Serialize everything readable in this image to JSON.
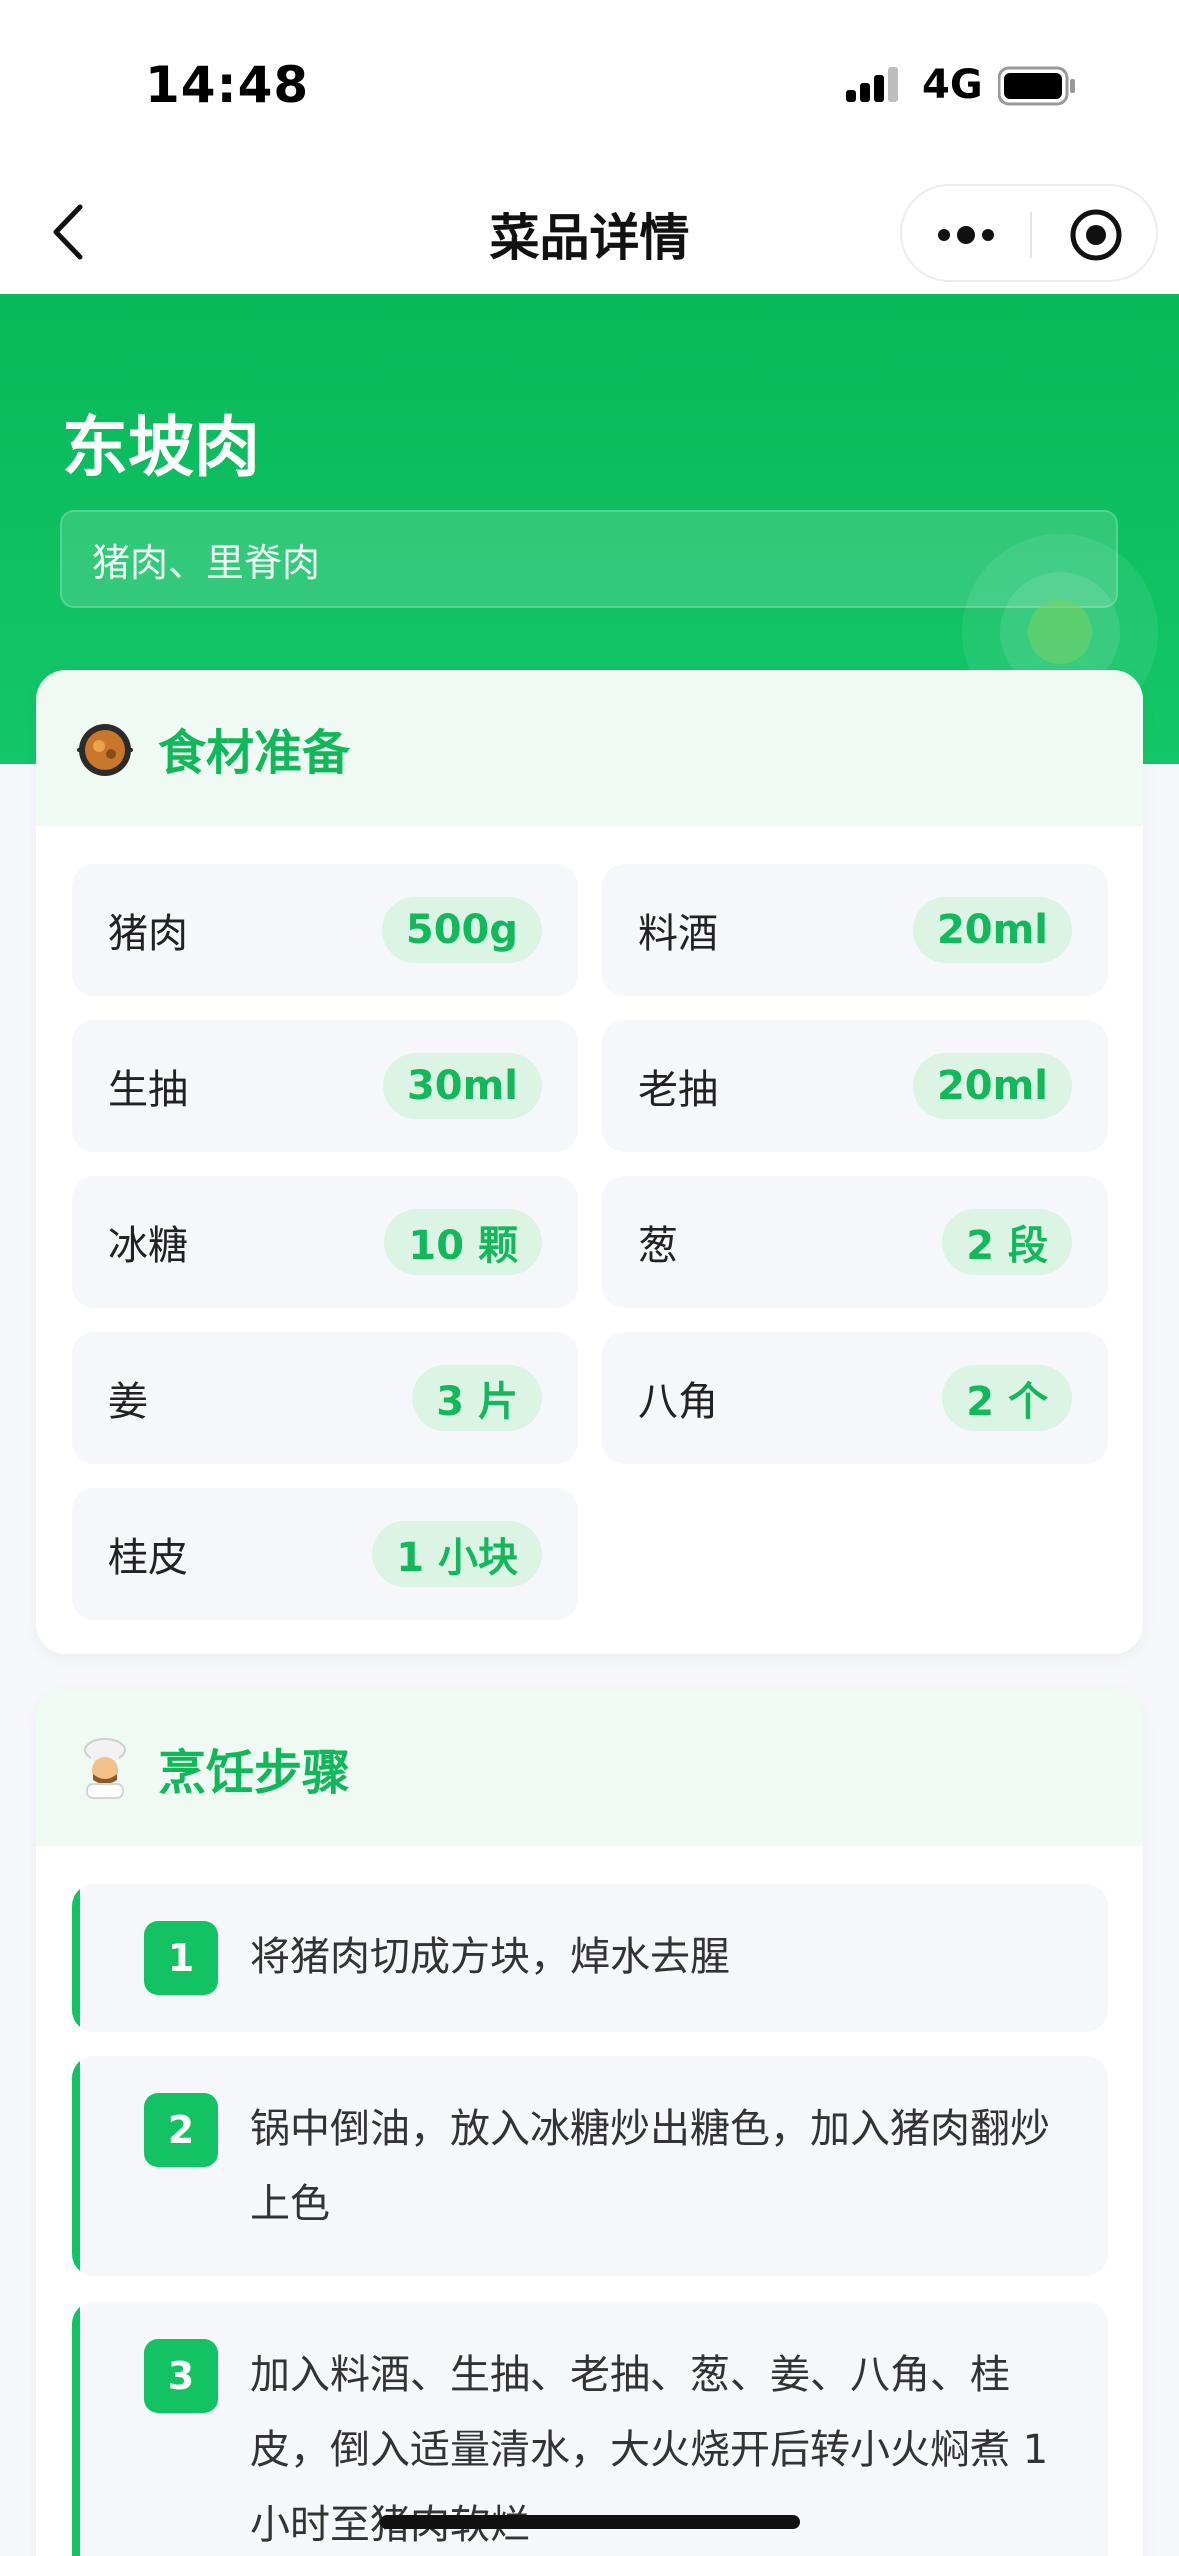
{
  "status_bar": {
    "time": "14:48",
    "network": "4G"
  },
  "nav": {
    "title": "菜品详情",
    "back_icon": "chevron-left-icon",
    "more_icon": "more-dots-icon",
    "close_icon": "target-circle-icon"
  },
  "dish": {
    "name": "东坡肉",
    "tags": "猪肉、里脊肉"
  },
  "ingredients": {
    "title": "食材准备",
    "icon": "cooking-pan-icon",
    "items": [
      {
        "name": "猪肉",
        "amount": "500g"
      },
      {
        "name": "料酒",
        "amount": "20ml"
      },
      {
        "name": "生抽",
        "amount": "30ml"
      },
      {
        "name": "老抽",
        "amount": "20ml"
      },
      {
        "name": "冰糖",
        "amount": "10 颗"
      },
      {
        "name": "葱",
        "amount": "2 段"
      },
      {
        "name": "姜",
        "amount": "3 片"
      },
      {
        "name": "八角",
        "amount": "2 个"
      },
      {
        "name": "桂皮",
        "amount": "1 小块"
      }
    ]
  },
  "steps": {
    "title": "烹饪步骤",
    "icon": "chef-icon",
    "items": [
      {
        "num": "1",
        "text": "将猪肉切成方块，焯水去腥"
      },
      {
        "num": "2",
        "text": "锅中倒油，放入冰糖炒出糖色，加入猪肉翻炒上色"
      },
      {
        "num": "3",
        "text": "加入料酒、生抽、老抽、葱、姜、八角、桂皮，倒入适量清水，大火烧开后转小火焖煮 1 小时至猪肉软烂"
      }
    ]
  },
  "colors": {
    "brand_green": "#08b859",
    "accent_green": "#12b85b",
    "tag_bg": "#dcf4e4",
    "header_bg": "#eefaf2"
  }
}
